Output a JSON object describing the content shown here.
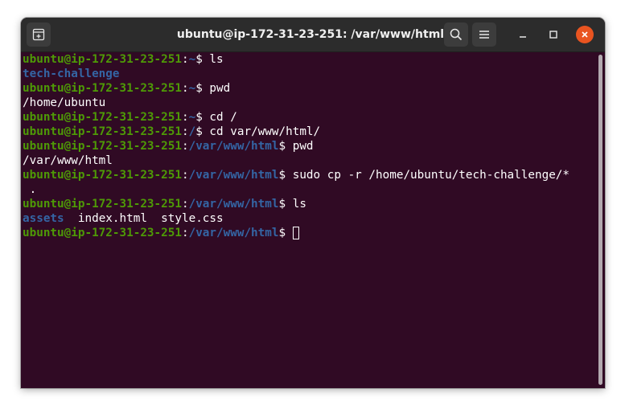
{
  "window": {
    "title": "ubuntu@ip-172-31-23-251: /var/www/html"
  },
  "titlebar": {
    "new_tab_icon": "new-tab-icon",
    "search_icon": "search-icon",
    "menu_icon": "hamburger-menu-icon",
    "minimize_icon": "minimize-icon",
    "maximize_icon": "maximize-icon",
    "close_icon": "close-icon"
  },
  "colors": {
    "terminal_bg": "#300a24",
    "prompt_user": "#4e9a06",
    "prompt_path": "#3465a4",
    "directory": "#3465a4",
    "close_button": "#e95420"
  },
  "terminal": {
    "prompt_user": "ubuntu@ip-172-31-23-251",
    "lines": [
      {
        "type": "prompt",
        "path": "~",
        "cmd": "ls"
      },
      {
        "type": "output",
        "parts": [
          {
            "text": "tech-challenge",
            "dir": true
          }
        ]
      },
      {
        "type": "prompt",
        "path": "~",
        "cmd": "pwd"
      },
      {
        "type": "output",
        "parts": [
          {
            "text": "/home/ubuntu",
            "dir": false
          }
        ]
      },
      {
        "type": "prompt",
        "path": "~",
        "cmd": "cd /"
      },
      {
        "type": "prompt",
        "path": "/",
        "cmd": "cd var/www/html/"
      },
      {
        "type": "prompt",
        "path": "/var/www/html",
        "cmd": "pwd"
      },
      {
        "type": "output",
        "parts": [
          {
            "text": "/var/www/html",
            "dir": false
          }
        ]
      },
      {
        "type": "prompt",
        "path": "/var/www/html",
        "cmd": "sudo cp -r /home/ubuntu/tech-challenge/*"
      },
      {
        "type": "output",
        "parts": [
          {
            "text": " .",
            "dir": false
          }
        ]
      },
      {
        "type": "prompt",
        "path": "/var/www/html",
        "cmd": "ls"
      },
      {
        "type": "output",
        "parts": [
          {
            "text": "assets",
            "dir": true
          },
          {
            "text": "  index.html  style.css",
            "dir": false
          }
        ]
      },
      {
        "type": "prompt",
        "path": "/var/www/html",
        "cmd": "",
        "cursor": true
      }
    ]
  }
}
